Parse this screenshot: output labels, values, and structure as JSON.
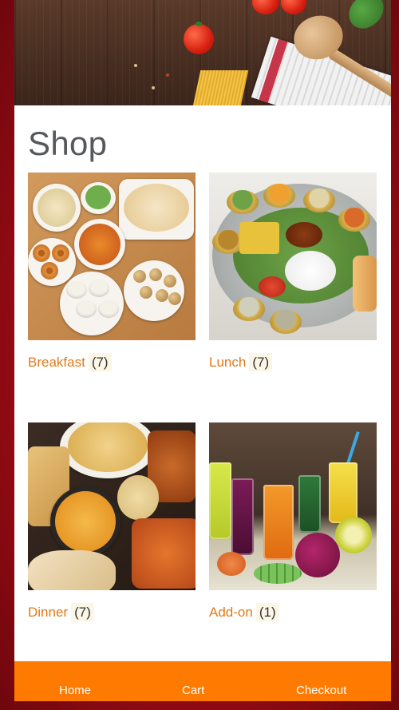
{
  "page": {
    "title": "Shop"
  },
  "categories": [
    {
      "name": "Breakfast",
      "count": "(7)",
      "image": "breakfast-photo"
    },
    {
      "name": "Lunch",
      "count": "(7)",
      "image": "lunch-thali-photo"
    },
    {
      "name": "Dinner",
      "count": "(7)",
      "image": "dinner-photo"
    },
    {
      "name": "Add-on",
      "count": "(1)",
      "image": "juices-photo"
    }
  ],
  "nav": {
    "home": "Home",
    "cart": "Cart",
    "checkout": "Checkout"
  },
  "colors": {
    "accent": "#e07a1a",
    "nav_bg": "#ff7a00",
    "frame": "#a30d16",
    "title": "#55585c"
  }
}
